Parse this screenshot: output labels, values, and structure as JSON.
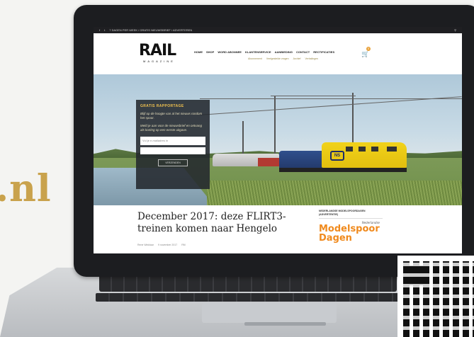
{
  "page_bg_text": ".nl",
  "colors": {
    "accent_gold": "#c9a24c",
    "ad_orange": "#f08a1d"
  },
  "topbar": {
    "social": [
      "f",
      "t"
    ],
    "tagline": "7 DAGEN PER WEEK / GRATIS NIEUWSBRIEF / ADVERTEREN"
  },
  "logo": {
    "title": "RAIL",
    "subtitle": "MAGAZINE"
  },
  "nav": {
    "items": [
      "HOME",
      "SHOP",
      "WORD ABONNEE",
      "KLANTENSERVICE",
      "AANBIEDING",
      "CONTACT",
      "RECTIFICATIES"
    ],
    "sub_items": [
      "Abonnement",
      "Veelgestelde vragen",
      "Archief",
      "Verhalingen"
    ],
    "cart_icon": "cart-icon",
    "cart_count": "0"
  },
  "popup": {
    "title": "GRATIS RAPPORTAGE",
    "text1": "Blijf op de hoogte van al het nieuws rondom het spoor.",
    "text2": "Meld je aan voor de nieuwsbrief en ontvang als korting op een eerste uitgave.",
    "email_placeholder": "Vul je e-mailadres in",
    "field2_placeholder": "",
    "send_label": "VERZENDEN"
  },
  "article": {
    "headline": "December 2017: deze FLIRT3-treinen komen naar Hengelo",
    "author": "Rene Winklaar",
    "date": "9 november 2017",
    "category": "RM"
  },
  "sidebar": {
    "title": "NEDERLANDSE MODELSPOORDAGEN (ADVERTENTIE)",
    "ad_small": "Nederlandse",
    "ad_line1": "Modelspoor",
    "ad_line2": "Dagen"
  },
  "hero": {
    "train_logo": "NS"
  }
}
